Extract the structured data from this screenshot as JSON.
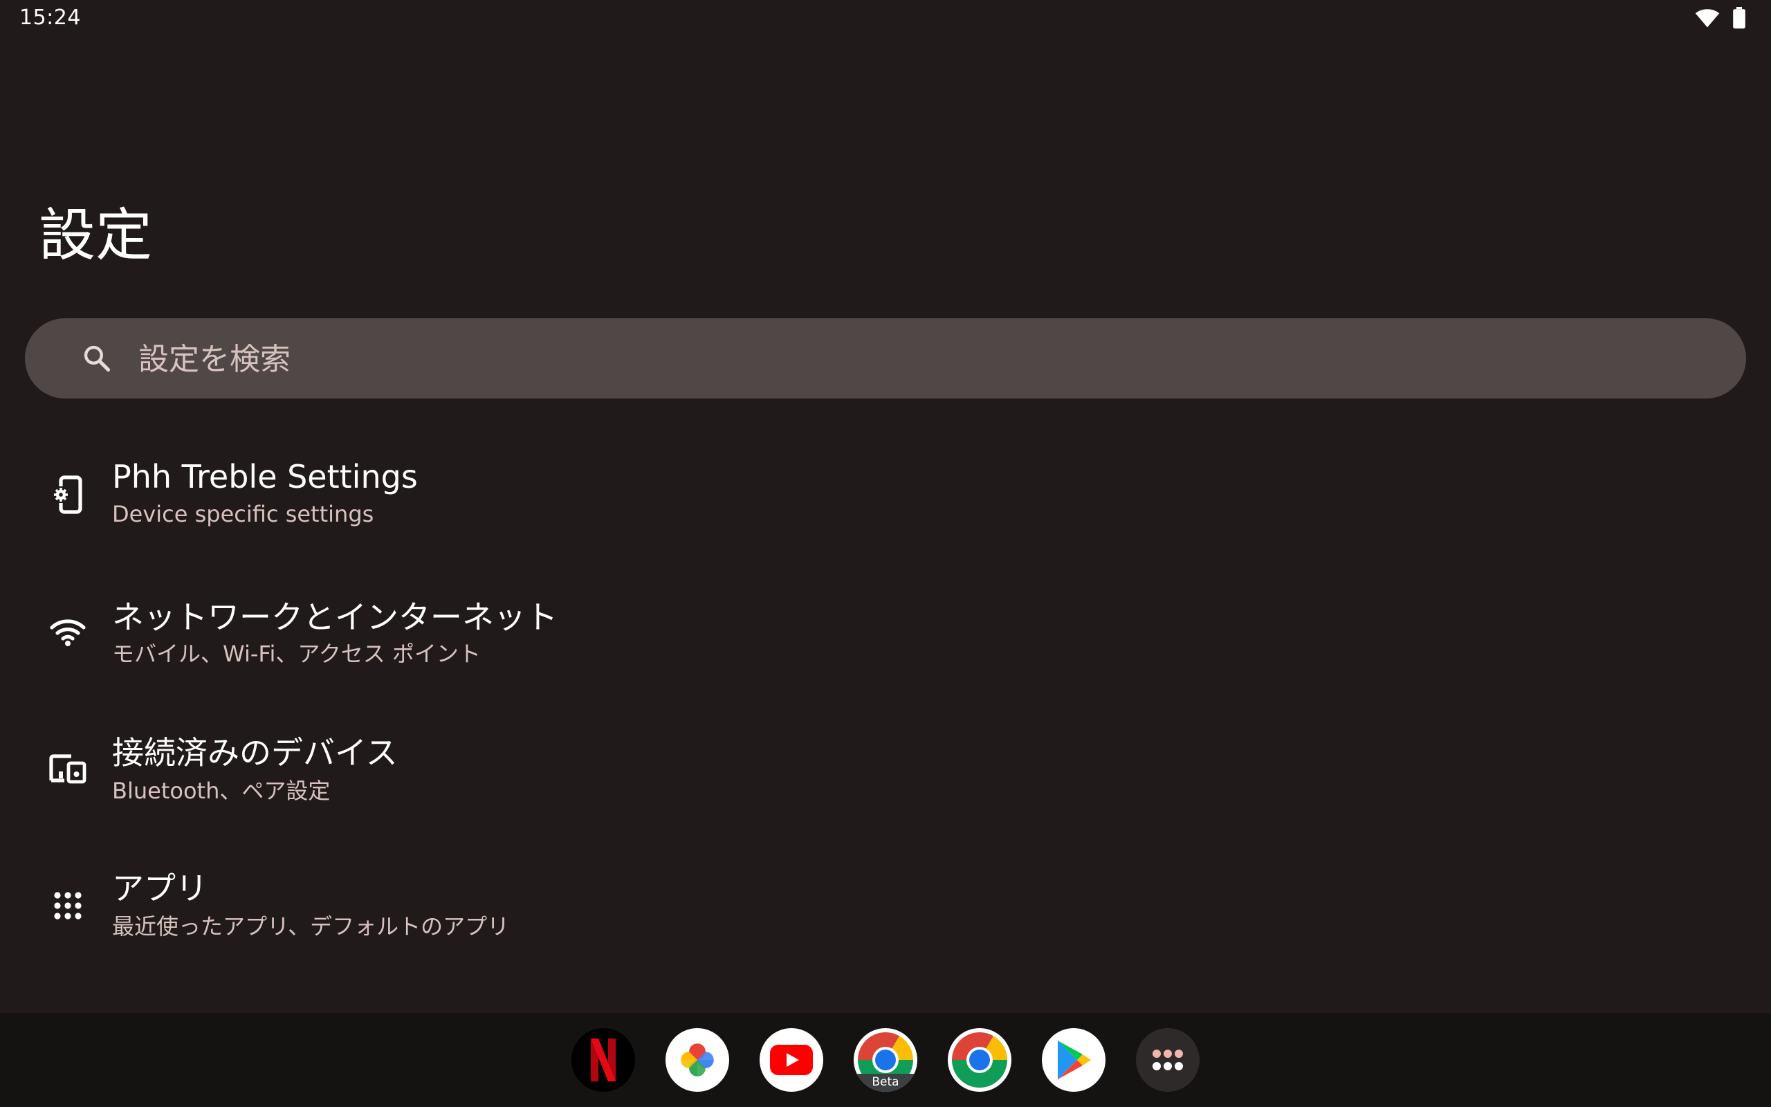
{
  "status_bar": {
    "time": "15:24",
    "icons": [
      "wifi-icon",
      "battery-icon"
    ]
  },
  "header": {
    "title": "設定"
  },
  "search": {
    "placeholder": "設定を検索",
    "icon": "search-icon"
  },
  "settings": {
    "items": [
      {
        "title": "Phh Treble Settings",
        "summary": "Device specific settings",
        "icon": "phone-gear-icon"
      },
      {
        "title": "ネットワークとインターネット",
        "summary": "モバイル、Wi-Fi、アクセス ポイント",
        "icon": "wifi-icon"
      },
      {
        "title": "接続済みのデバイス",
        "summary": "Bluetooth、ペア設定",
        "icon": "devices-icon"
      },
      {
        "title": "アプリ",
        "summary": "最近使ったアプリ、デフォルトのアプリ",
        "icon": "apps-grid-icon"
      }
    ]
  },
  "taskbar": {
    "apps": [
      {
        "name": "netflix-app-icon"
      },
      {
        "name": "google-photos-app-icon"
      },
      {
        "name": "youtube-app-icon"
      },
      {
        "name": "chrome-beta-app-icon",
        "badge": "Beta"
      },
      {
        "name": "chrome-app-icon"
      },
      {
        "name": "play-store-app-icon"
      },
      {
        "name": "all-apps-icon"
      }
    ]
  },
  "colors": {
    "background": "#201a1a",
    "search_bar": "#504847",
    "taskbar": "#151212",
    "title_text": "#ffffff",
    "summary_text": "#d8c2bf"
  }
}
